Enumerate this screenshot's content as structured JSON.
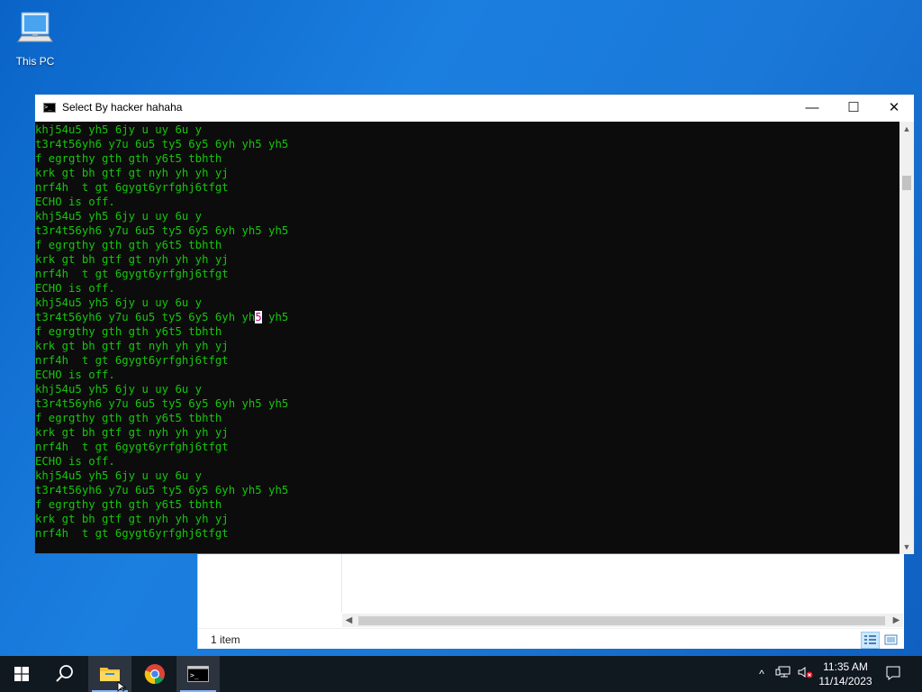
{
  "desktop": {
    "icons": [
      {
        "label": "This PC",
        "icon": "computer-icon"
      }
    ]
  },
  "explorer": {
    "status_count": "1 item"
  },
  "console": {
    "title": "Select By hacker hahaha",
    "minimize_glyph": "—",
    "maximize_glyph": "☐",
    "close_glyph": "✕",
    "cursor_line_index": 13,
    "cursor_line_before": "t3r4t56yh6 y7u 6u5 ty5 6y5 6yh yh",
    "cursor_char": "5",
    "cursor_line_after": " yh5",
    "lines": [
      "khj54u5 yh5 6jy u uy 6u y",
      "t3r4t56yh6 y7u 6u5 ty5 6y5 6yh yh5 yh5",
      "f egrgthy gth gth y6t5 tbhth",
      "krk gt bh gtf gt nyh yh yh yj",
      "nrf4h  t gt 6gygt6yrfghj6tfgt",
      "ECHO is off.",
      "khj54u5 yh5 6jy u uy 6u y",
      "t3r4t56yh6 y7u 6u5 ty5 6y5 6yh yh5 yh5",
      "f egrgthy gth gth y6t5 tbhth",
      "krk gt bh gtf gt nyh yh yh yj",
      "nrf4h  t gt 6gygt6yrfghj6tfgt",
      "ECHO is off.",
      "khj54u5 yh5 6jy u uy 6u y",
      "t3r4t56yh6 y7u 6u5 ty5 6y5 6yh yh5 yh5",
      "f egrgthy gth gth y6t5 tbhth",
      "krk gt bh gtf gt nyh yh yh yj",
      "nrf4h  t gt 6gygt6yrfghj6tfgt",
      "ECHO is off.",
      "khj54u5 yh5 6jy u uy 6u y",
      "t3r4t56yh6 y7u 6u5 ty5 6y5 6yh yh5 yh5",
      "f egrgthy gth gth y6t5 tbhth",
      "krk gt bh gtf gt nyh yh yh yj",
      "nrf4h  t gt 6gygt6yrfghj6tfgt",
      "ECHO is off.",
      "khj54u5 yh5 6jy u uy 6u y",
      "t3r4t56yh6 y7u 6u5 ty5 6y5 6yh yh5 yh5",
      "f egrgthy gth gth y6t5 tbhth",
      "krk gt bh gtf gt nyh yh yh yj",
      "nrf4h  t gt 6gygt6yrfghj6tfgt"
    ],
    "text_color": "#16c60c",
    "background_color": "#0c0c0c"
  },
  "taskbar": {
    "items": [
      {
        "name": "start-button",
        "icon": "windows-logo-icon"
      },
      {
        "name": "search-button",
        "icon": "search-icon"
      },
      {
        "name": "file-explorer-button",
        "icon": "folder-icon"
      },
      {
        "name": "chrome-button",
        "icon": "chrome-icon"
      },
      {
        "name": "command-prompt-button",
        "icon": "cmd-icon"
      }
    ],
    "tray": {
      "chevron_glyph": "^",
      "time": "11:35 AM",
      "date": "11/14/2023"
    }
  }
}
